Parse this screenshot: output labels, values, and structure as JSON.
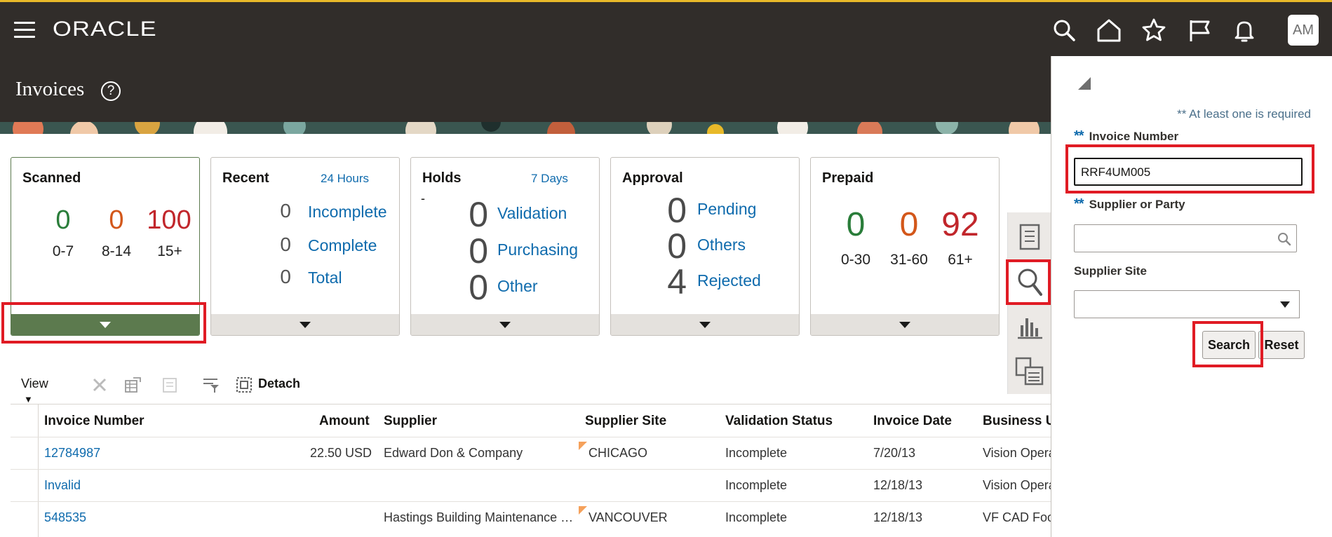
{
  "header": {
    "logo": "ORACLE",
    "page_title": "Invoices",
    "avatar_initials": "AM",
    "help_glyph": "?"
  },
  "infolets": {
    "scanned": {
      "title": "Scanned",
      "values": [
        "0",
        "0",
        "100"
      ],
      "labels": [
        "0-7",
        "8-14",
        "15+"
      ]
    },
    "recent": {
      "title": "Recent",
      "period": "24 Hours",
      "rows": [
        {
          "value": "0",
          "label": "Incomplete"
        },
        {
          "value": "0",
          "label": "Complete"
        },
        {
          "value": "0",
          "label": "Total"
        }
      ]
    },
    "holds": {
      "title": "Holds",
      "period": "7 Days",
      "dash": "-",
      "rows": [
        {
          "value": "0",
          "label": "Validation"
        },
        {
          "value": "0",
          "label": "Purchasing"
        },
        {
          "value": "0",
          "label": "Other"
        }
      ]
    },
    "approval": {
      "title": "Approval",
      "rows": [
        {
          "value": "0",
          "label": "Pending"
        },
        {
          "value": "0",
          "label": "Others"
        },
        {
          "value": "4",
          "label": "Rejected"
        }
      ]
    },
    "prepaid": {
      "title": "Prepaid",
      "values": [
        "0",
        "0",
        "92"
      ],
      "labels": [
        "0-30",
        "31-60",
        "61+"
      ]
    }
  },
  "toolbar": {
    "view_label": "View",
    "detach_label": "Detach"
  },
  "table": {
    "columns": [
      "Invoice Number",
      "Amount",
      "Supplier",
      "Supplier Site",
      "Validation Status",
      "Invoice Date",
      "Business Unit"
    ],
    "rows": [
      {
        "invoice": "12784987",
        "amount": "22.50 USD",
        "supplier": "Edward Don & Company",
        "site": "CHICAGO",
        "status": "Incomplete",
        "date": "7/20/13",
        "bu": "Vision Operations"
      },
      {
        "invoice": "Invalid",
        "amount": "",
        "supplier": "",
        "site": "",
        "status": "Incomplete",
        "date": "12/18/13",
        "bu": "Vision Operations"
      },
      {
        "invoice": "548535",
        "amount": "",
        "supplier": "Hastings Building Maintenance …",
        "site": "VANCOUVER",
        "status": "Incomplete",
        "date": "12/18/13",
        "bu": "VF CAD Foods"
      }
    ]
  },
  "search_panel": {
    "required_note": "** At least one is required",
    "required_marker": "**",
    "invoice_number_label": "Invoice Number",
    "invoice_number_value": "RRF4UM005",
    "supplier_label": "Supplier or Party",
    "supplier_value": "",
    "supplier_site_label": "Supplier Site",
    "supplier_site_value": "",
    "search_button": "Search",
    "reset_button": "Reset"
  },
  "colors": {
    "header_bg": "#312d2a",
    "link": "#0f6bad",
    "scanned_green": "#5c7a4e",
    "highlight": "#e01b24"
  }
}
